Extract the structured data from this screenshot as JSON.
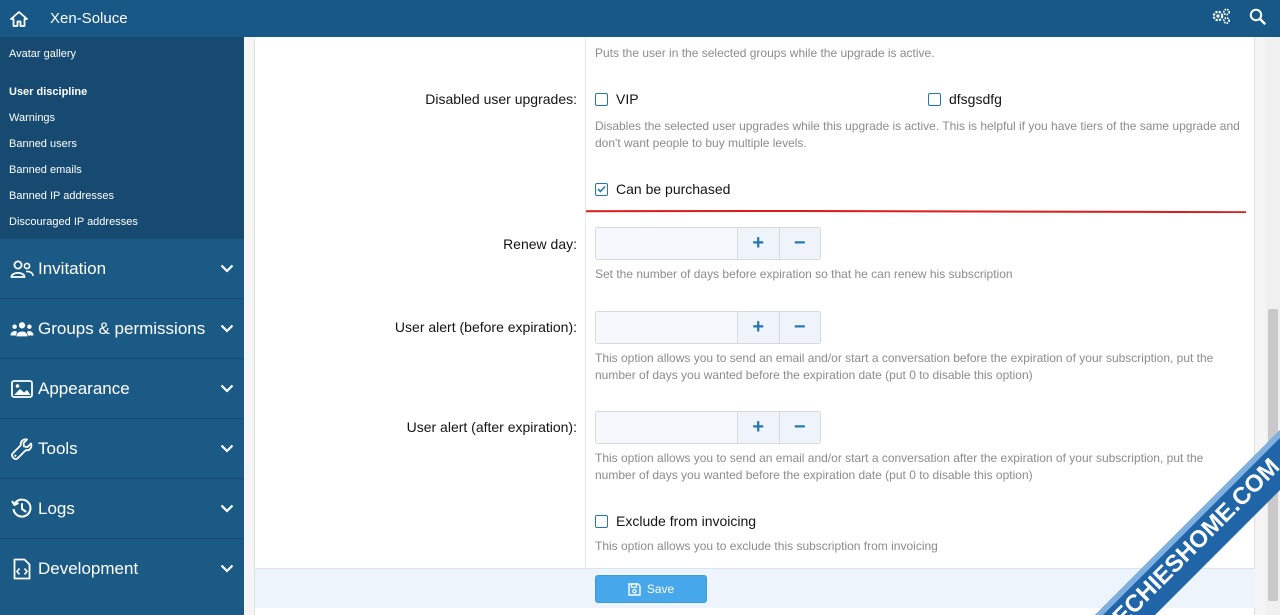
{
  "topbar": {
    "brand": "Xen-Soluce"
  },
  "sidebar": {
    "sub_items": [
      {
        "label": "Avatar gallery"
      },
      {
        "label": "User discipline",
        "heading": true
      },
      {
        "label": "Warnings"
      },
      {
        "label": "Banned users"
      },
      {
        "label": "Banned emails"
      },
      {
        "label": "Banned IP addresses"
      },
      {
        "label": "Discouraged IP addresses"
      }
    ],
    "sections": [
      {
        "label": "Invitation",
        "icon": "users-icon"
      },
      {
        "label": "Groups & permissions",
        "icon": "user-group-icon"
      },
      {
        "label": "Appearance",
        "icon": "image-icon"
      },
      {
        "label": "Tools",
        "icon": "wrench-icon"
      },
      {
        "label": "Logs",
        "icon": "history-icon"
      },
      {
        "label": "Development",
        "icon": "code-file-icon"
      }
    ]
  },
  "form": {
    "groups_hint": "Puts the user in the selected groups while the upgrade is active.",
    "disabled_upgrades": {
      "label": "Disabled user upgrades:",
      "options": [
        {
          "label": "VIP",
          "checked": false
        },
        {
          "label": "dfsgsdfg",
          "checked": false
        }
      ],
      "hint": "Disables the selected user upgrades while this upgrade is active. This is helpful if you have tiers of the same upgrade and don't want people to buy multiple levels."
    },
    "can_be_purchased": {
      "label": "Can be purchased",
      "checked": true
    },
    "renew_day": {
      "label": "Renew day:",
      "value": "",
      "hint": "Set the number of days before expiration so that he can renew his subscription"
    },
    "alert_before": {
      "label": "User alert (before expiration):",
      "value": "",
      "hint": "This option allows you to send an email and/or start a conversation before the expiration of your subscription, put the number of days you wanted before the expiration date (put 0 to disable this option)"
    },
    "alert_after": {
      "label": "User alert (after expiration):",
      "value": "",
      "hint": "This option allows you to send an email and/or start a conversation after the expiration of your subscription, put the number of days you wanted before the expiration date (put 0 to disable this option)"
    },
    "exclude_invoicing": {
      "label": "Exclude from invoicing",
      "checked": false,
      "hint": "This option allows you to exclude this subscription from invoicing"
    },
    "stepper": {
      "plus": "+",
      "minus": "−"
    },
    "save_label": "Save"
  },
  "watermark": {
    "text": "TECHIESHOME.COM"
  },
  "colors": {
    "topbar": "#185886",
    "sidebar": "#1c5a86",
    "sidebar_sub": "#164a70",
    "accent": "#2577b1",
    "save": "#47a7eb",
    "annotation_line": "#e01b1b",
    "watermark_band": "#1f65a8"
  }
}
